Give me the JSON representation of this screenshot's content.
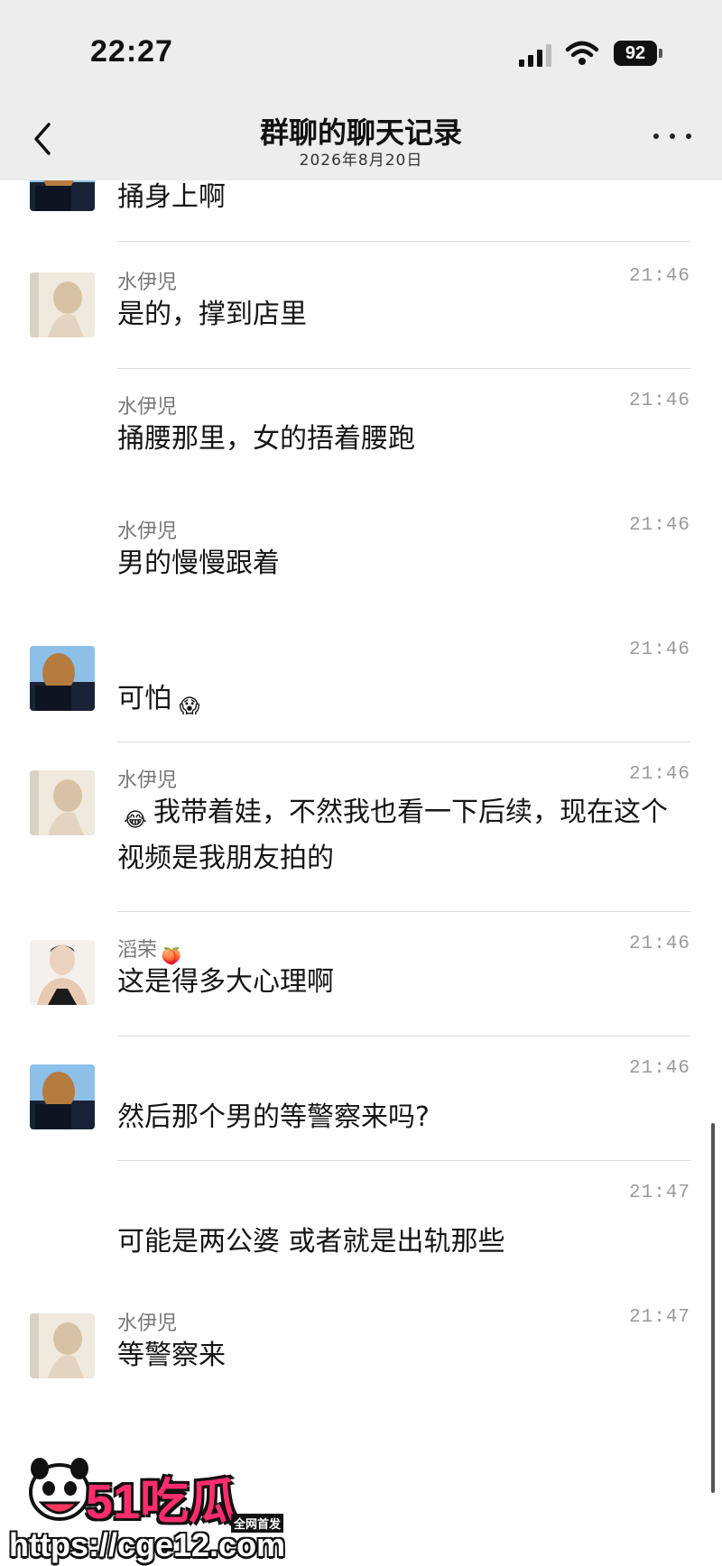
{
  "status_bar": {
    "time": "22:27",
    "battery": "92"
  },
  "header": {
    "title": "群聊的聊天记录",
    "subtitle": "2026年8月20日"
  },
  "messages": [
    {
      "name": "",
      "time": "",
      "text": "捅身上啊",
      "avatar": "user-b"
    },
    {
      "name": "水伊児",
      "time": "21:46",
      "text": "是的，撑到店里",
      "avatar": "user-a"
    },
    {
      "name": "水伊児",
      "time": "21:46",
      "text": "捅腰那里，女的捂着腰跑",
      "avatar": ""
    },
    {
      "name": "水伊児",
      "time": "21:46",
      "text": "男的慢慢跟着",
      "avatar": ""
    },
    {
      "name": "",
      "time": "21:46",
      "text": "可怕",
      "emoji_after": "😱",
      "avatar": "user-b"
    },
    {
      "name": "水伊児",
      "time": "21:46",
      "emoji_before": "😂",
      "text": "我带着娃，不然我也看一下后续，现在这个视频是我朋友拍的",
      "avatar": "user-a"
    },
    {
      "name": "滔荣",
      "name_emoji": "🍑",
      "time": "21:46",
      "text": "这是得多大心理啊",
      "avatar": "user-c"
    },
    {
      "name": "",
      "time": "21:46",
      "text": "然后那个男的等警察来吗?",
      "avatar": "user-b"
    },
    {
      "name": "",
      "time": "21:47",
      "text": "可能是两公婆 或者就是出轨那些",
      "avatar": ""
    },
    {
      "name": "水伊児",
      "time": "21:47",
      "text": "等警察来",
      "avatar": "user-a"
    }
  ],
  "watermark": {
    "brand": "51吃瓜",
    "tag": "全网首发",
    "url": "https://cge12.com"
  },
  "colors": {
    "header_bg": "#ededed",
    "text": "#151515",
    "meta": "#9a9a9a",
    "brand": "#ff2d6e"
  },
  "icons": [
    "back-chevron-icon",
    "more-dots-icon",
    "signal-icon",
    "wifi-icon",
    "battery-icon"
  ]
}
